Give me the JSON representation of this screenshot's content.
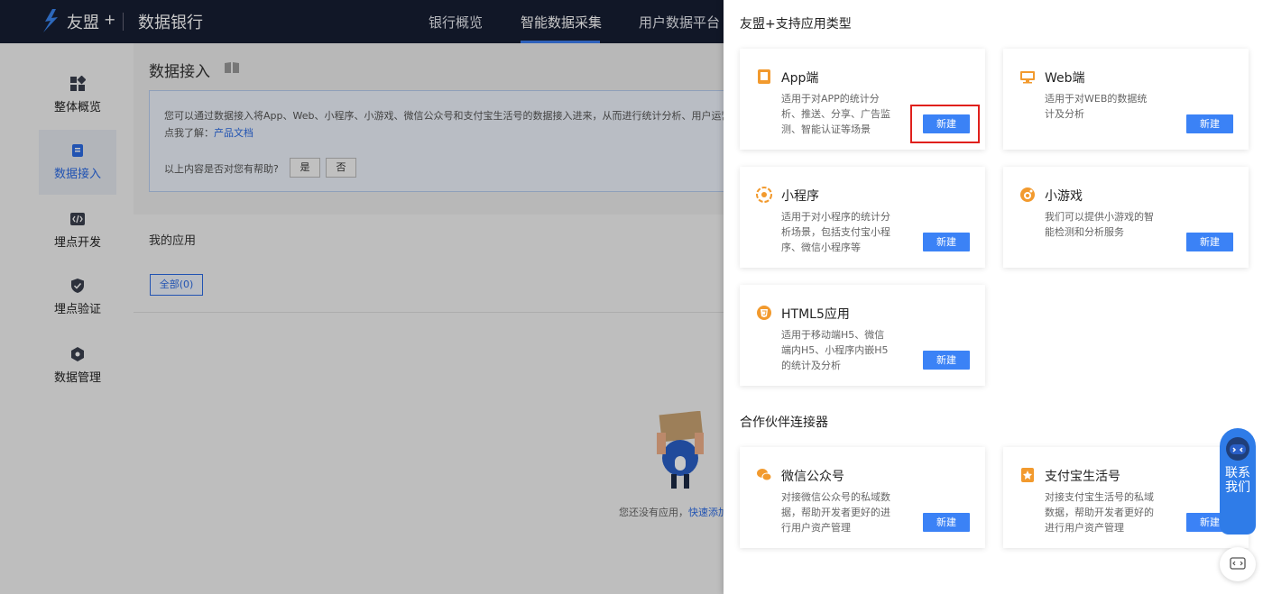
{
  "topbar": {
    "brand": "友盟",
    "brand_plus": "+",
    "product": "数据银行",
    "nav": [
      "银行概览",
      "智能数据采集",
      "用户数据平台"
    ]
  },
  "sidebar": {
    "items": [
      {
        "label": "整体概览",
        "icon": "grid-icon"
      },
      {
        "label": "数据接入",
        "icon": "data-access-icon"
      },
      {
        "label": "埋点开发",
        "icon": "code-icon"
      },
      {
        "label": "埋点验证",
        "icon": "shield-icon"
      },
      {
        "label": "数据管理",
        "icon": "hexagon-icon"
      }
    ]
  },
  "main": {
    "title": "数据接入",
    "info_text": "您可以通过数据接入将App、Web、小程序、小游戏、微信公众号和支付宝生活号的数据接入进来，从而进行统计分析、用户运营",
    "info_prefix": "点我了解：",
    "info_link": "产品文档",
    "help_question": "以上内容是否对您有帮助?",
    "help_yes": "是",
    "help_no": "否",
    "apps_header": "我的应用",
    "all_tab": "全部(0)",
    "empty_text": "您还没有应用，",
    "empty_link": "快速添加"
  },
  "drawer": {
    "section1_title": "友盟+支持应用类型",
    "section2_title": "合作伙伴连接器",
    "new_label": "新建",
    "cards": [
      {
        "title": "App端",
        "desc": "适用于对APP的统计分析、推送、分享、广告监测、智能认证等场景",
        "icon": "mobile-icon"
      },
      {
        "title": "Web端",
        "desc": "适用于对WEB的数据统计及分析",
        "icon": "monitor-icon"
      },
      {
        "title": "小程序",
        "desc": "适用于对小程序的统计分析场景，包括支付宝小程序、微信小程序等",
        "icon": "miniprogram-icon"
      },
      {
        "title": "小游戏",
        "desc": "我们可以提供小游戏的智能检测和分析服务",
        "icon": "minigame-icon"
      },
      {
        "title": "HTML5应用",
        "desc": "适用于移动端H5、微信端内H5、小程序内嵌H5的统计及分析",
        "icon": "html5-icon"
      }
    ],
    "partners": [
      {
        "title": "微信公众号",
        "desc": "对接微信公众号的私域数据，帮助开发者更好的进行用户资产管理",
        "icon": "wechat-icon"
      },
      {
        "title": "支付宝生活号",
        "desc": "对接支付宝生活号的私域数据，帮助开发者更好的进行用户资产管理",
        "icon": "alipay-life-icon"
      }
    ]
  },
  "contact": {
    "label": "联系我们"
  },
  "colors": {
    "topbar": "#171e33",
    "accent": "#3b82f6",
    "icon_orange": "#f29a2e",
    "highlight": "#e0201c"
  }
}
